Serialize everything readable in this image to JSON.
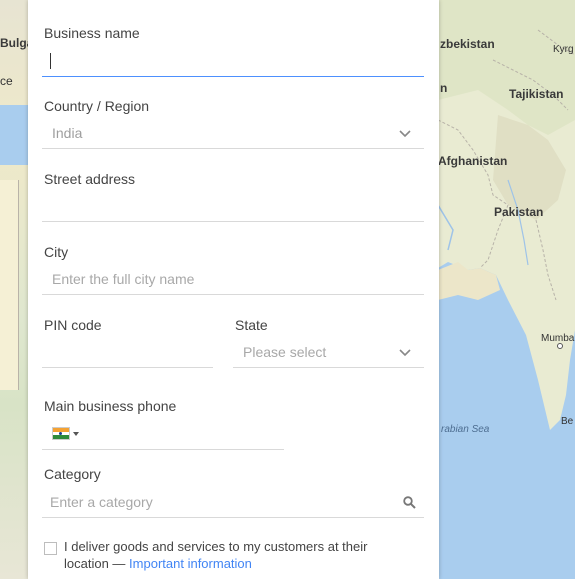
{
  "map": {
    "labels": {
      "bulgaria": "Bulga",
      "greece": "ce",
      "uzbekistan": "zbekistan",
      "kyrgyz": "Kyrg",
      "tajikistan": "Tajikistan",
      "turkmen": "n",
      "afghanistan": "Afghanistan",
      "pakistan": "Pakistan",
      "mumbai": "Mumba",
      "arabian_sea": "rabian Sea",
      "bengaluru": "Be"
    }
  },
  "form": {
    "business_name": {
      "label": "Business name",
      "value": ""
    },
    "country": {
      "label": "Country / Region",
      "value": "India",
      "icon": "chevron-down-icon"
    },
    "street": {
      "label": "Street address",
      "value": ""
    },
    "city": {
      "label": "City",
      "placeholder": "Enter the full city name"
    },
    "pin": {
      "label": "PIN code",
      "value": ""
    },
    "state": {
      "label": "State",
      "placeholder": "Please select",
      "icon": "chevron-down-icon"
    },
    "phone": {
      "label": "Main business phone",
      "flag": "india-flag-icon",
      "value": ""
    },
    "category": {
      "label": "Category",
      "placeholder": "Enter a category",
      "icon": "search-icon"
    },
    "deliver": {
      "text_line1": "I deliver goods and services to my customers at their",
      "text_line2": "location —",
      "link": "Important information",
      "checked": false
    }
  },
  "colors": {
    "accent": "#4d90fe",
    "link": "#4285f4",
    "label": "#444444",
    "placeholder": "#a8a8a8",
    "divider": "#d9d9d9"
  }
}
